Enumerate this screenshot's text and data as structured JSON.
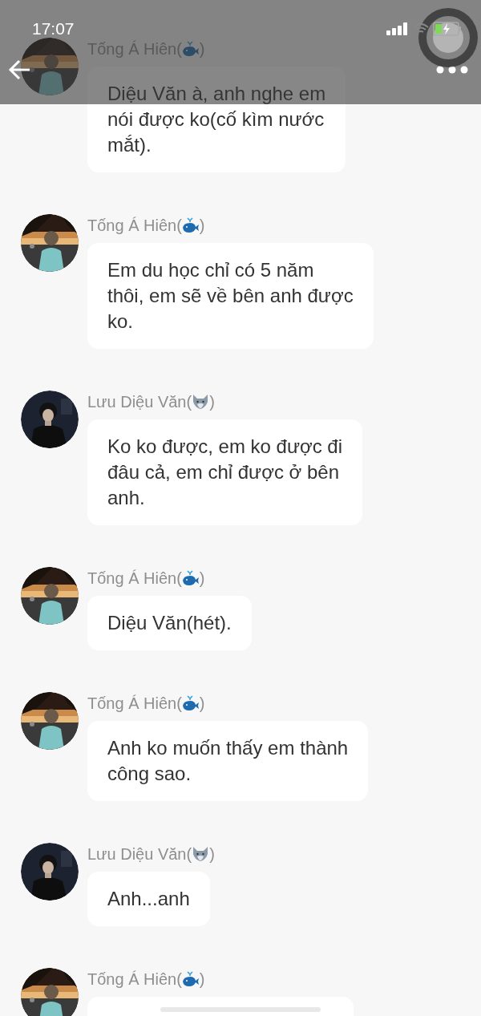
{
  "status_bar": {
    "time": "17:07"
  },
  "messages": [
    {
      "kind": "whale",
      "name_open": "Tống Á Hiên(",
      "name_close": ")",
      "lines": [
        "Diệu Văn à, anh nghe em",
        "nói được ko(cố kìm nước",
        "mắt)."
      ]
    },
    {
      "kind": "whale",
      "name_open": "Tống Á Hiên(",
      "name_close": ")",
      "lines": [
        "Em du học chỉ có 5 năm",
        "thôi, em sẽ về bên anh được",
        "ko."
      ]
    },
    {
      "kind": "wolf",
      "name_open": "Lưu Diệu Văn(",
      "name_close": ")",
      "lines": [
        "Ko ko được, em ko được đi",
        "đâu cả, em chỉ được ở bên",
        "anh."
      ]
    },
    {
      "kind": "whale",
      "name_open": "Tống Á Hiên(",
      "name_close": ")",
      "lines": [
        "Diệu Văn(hét)."
      ]
    },
    {
      "kind": "whale",
      "name_open": "Tống Á Hiên(",
      "name_close": ")",
      "lines": [
        "Anh ko muốn thấy em thành",
        "công sao."
      ]
    },
    {
      "kind": "wolf",
      "name_open": "Lưu Diệu Văn(",
      "name_close": ")",
      "lines": [
        "Anh...anh"
      ]
    },
    {
      "kind": "whale",
      "name_open": "Tống Á Hiên(",
      "name_close": ")"
    }
  ]
}
